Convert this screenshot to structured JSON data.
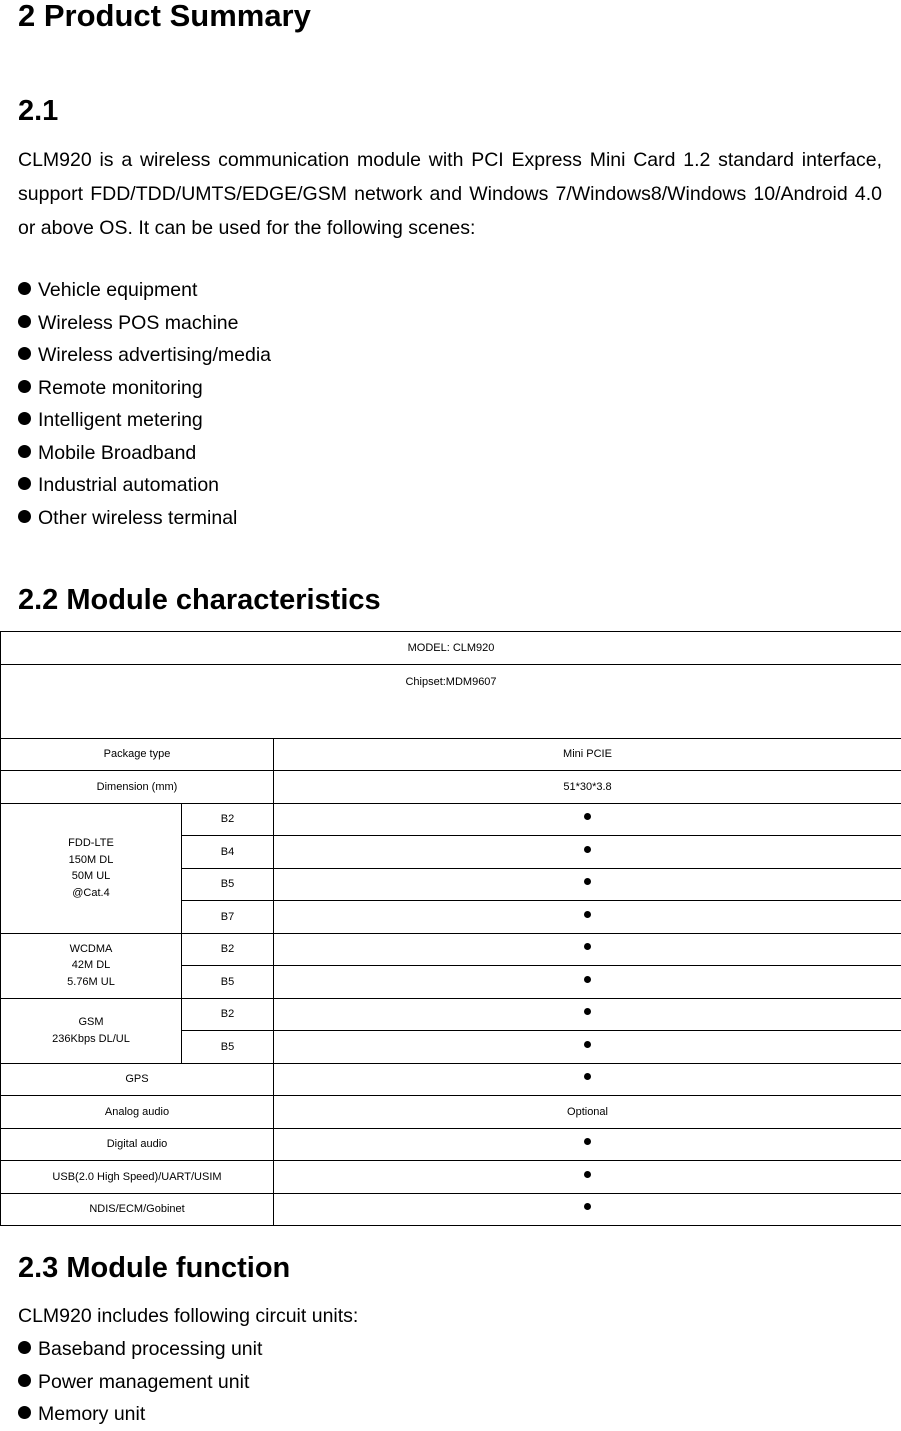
{
  "page_title": "2 Product Summary",
  "section_2_1": {
    "heading": "2.1",
    "paragraph": "CLM920 is a wireless communication module with PCI Express Mini Card 1.2 standard interface, support FDD/TDD/UMTS/EDGE/GSM network and Windows 7/Windows8/Windows 10/Android 4.0 or above OS. It can be used for the following scenes:",
    "bullets": [
      "Vehicle equipment",
      "Wireless POS machine",
      "Wireless advertising/media",
      "Remote monitoring",
      "Intelligent metering",
      "Mobile Broadband",
      "Industrial automation",
      "Other wireless terminal"
    ]
  },
  "section_2_2": {
    "heading": "2.2 Module characteristics",
    "table": {
      "model": "MODEL: CLM920",
      "chipset": "Chipset:MDM9607",
      "package_type": {
        "label": "Package type",
        "value": "Mini PCIE"
      },
      "dimension": {
        "label": "Dimension (mm)",
        "value": "51*30*3.8"
      },
      "fdd_lte": {
        "label_lines": [
          "FDD-LTE",
          "150M DL",
          "50M UL",
          "@Cat.4"
        ],
        "bands": [
          {
            "band": "B2",
            "supported": true
          },
          {
            "band": "B4",
            "supported": true
          },
          {
            "band": "B5",
            "supported": true
          },
          {
            "band": "B7",
            "supported": true
          }
        ]
      },
      "wcdma": {
        "label_lines": [
          "WCDMA",
          "42M DL",
          "5.76M UL"
        ],
        "bands": [
          {
            "band": "B2",
            "supported": true
          },
          {
            "band": "B5",
            "supported": true
          }
        ]
      },
      "gsm": {
        "label_lines": [
          "GSM",
          "236Kbps DL/UL"
        ],
        "bands": [
          {
            "band": "B2",
            "supported": true
          },
          {
            "band": "B5",
            "supported": true
          }
        ]
      },
      "features": [
        {
          "label": "GPS",
          "value": "supported"
        },
        {
          "label": "Analog audio",
          "value": "Optional"
        },
        {
          "label": "Digital audio",
          "value": "supported"
        },
        {
          "label": "USB(2.0 High Speed)/UART/USIM",
          "value": "supported"
        },
        {
          "label": "NDIS/ECM/Gobinet",
          "value": "supported"
        }
      ],
      "supported_mark": "●"
    }
  },
  "section_2_3": {
    "heading": "2.3 Module function",
    "intro": "CLM920 includes following circuit units:",
    "bullets": [
      "Baseband processing unit",
      "Power management unit",
      "Memory unit"
    ]
  }
}
